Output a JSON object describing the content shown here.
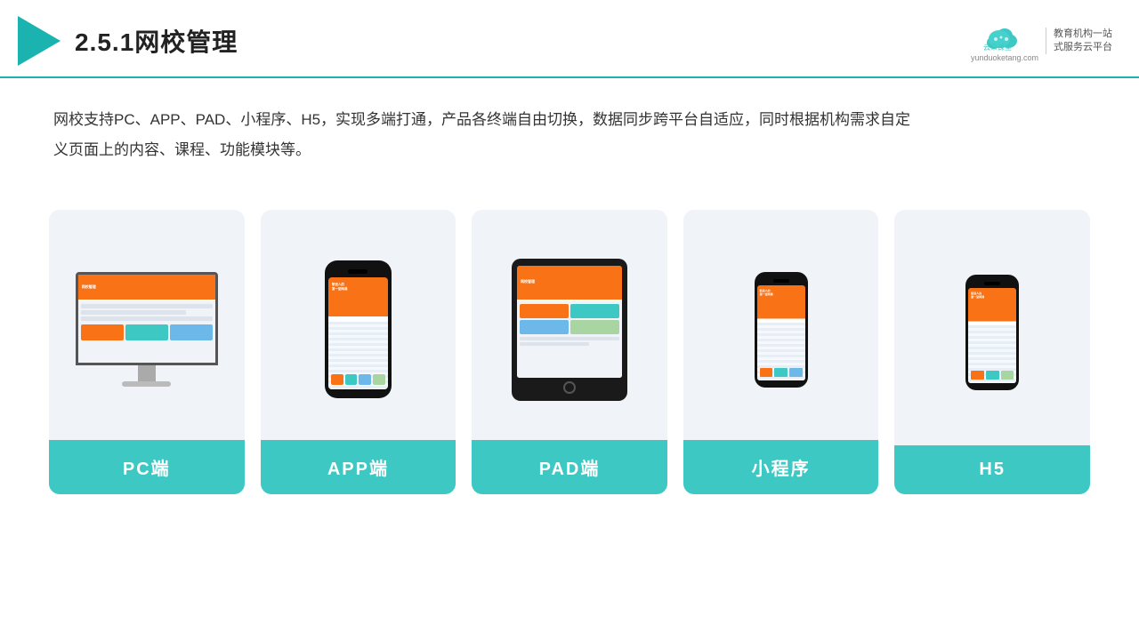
{
  "header": {
    "title": "2.5.1网校管理",
    "logo_name": "云朵课堂",
    "logo_url": "yunduoketang.com",
    "logo_slogan_line1": "教育机构一站",
    "logo_slogan_line2": "式服务云平台"
  },
  "description": {
    "text": "网校支持PC、APP、PAD、小程序、H5，实现多端打通，产品各终端自由切换，数据同步跨平台自适应，同时根据机构需求自定义页面上的内容、课程、功能模块等。"
  },
  "cards": [
    {
      "id": "pc",
      "label": "PC端"
    },
    {
      "id": "app",
      "label": "APP端"
    },
    {
      "id": "pad",
      "label": "PAD端"
    },
    {
      "id": "miniprogram",
      "label": "小程序"
    },
    {
      "id": "h5",
      "label": "H5"
    }
  ]
}
